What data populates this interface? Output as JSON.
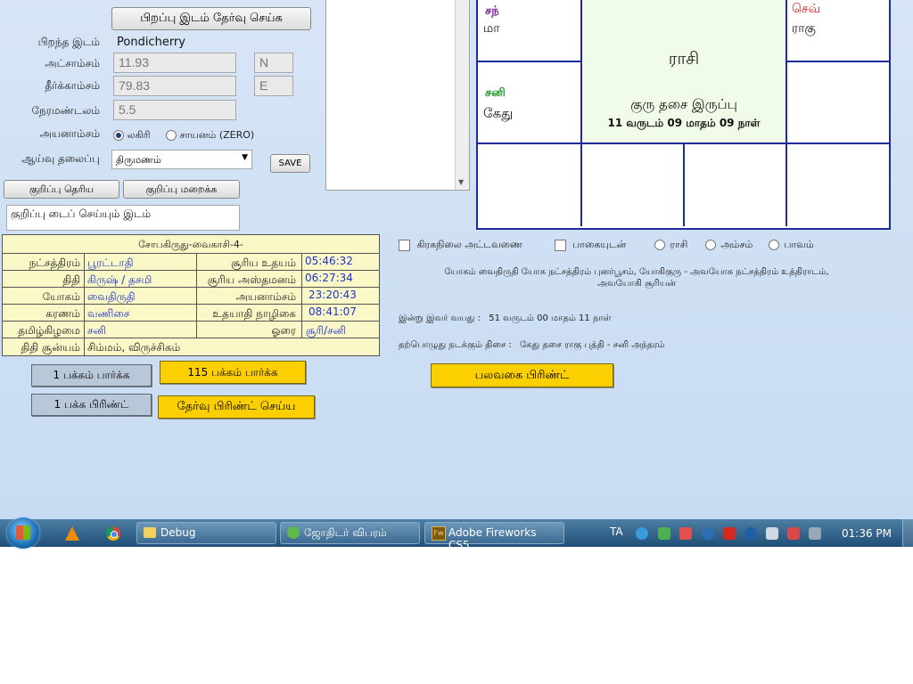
{
  "form": {
    "select_place_button": "பிறப்பு இடம் தேர்வு செய்க",
    "birth_place_label": "பிறந்த இடம்",
    "birth_place_value": "Pondicherry",
    "latitude_label": "அட்சாம்சம்",
    "latitude_value": "11.93",
    "latitude_dir": "N",
    "longitude_label": "தீர்க்காம்சம்",
    "longitude_value": "79.83",
    "longitude_dir": "E",
    "timezone_label": "நேரமண்டலம்",
    "timezone_value": "5.5",
    "ayanamsa_label": "அயனாம்சம்",
    "ayanamsa_options": [
      "லகிரி",
      "சாயனம் (ZERO)"
    ],
    "topic_label": "ஆய்வு தலைப்பு",
    "topic_value": "திருமணம்",
    "save_button": "SAVE",
    "show_notes_button": "குறிப்பு தெரிய",
    "hide_notes_button": "குறிப்பு மறைக்க",
    "notes_text": "குறிப்பு டைப் செய்யும் இடம்"
  },
  "chart": {
    "top_left_planet": "சந்",
    "top_left_planet2": "மா",
    "top_right_planet": "செவ்",
    "top_right_planet2": "ராகு",
    "mid_left_planet": "சனி",
    "mid_left_planet2": "கேது",
    "center_title": "ராசி",
    "center_line1": "குரு தசை இருப்பு",
    "center_line2": "11 வருடம் 09 மாதம் 09 நாள்"
  },
  "details": {
    "header": "சோபகிருது-வைகாசி-4-",
    "rows": [
      {
        "k1": "நட்சத்திரம்",
        "v1": "பூரட்டாதி",
        "k2": "சூரிய உதயம்",
        "v2": "05:46:32"
      },
      {
        "k1": "திதி",
        "v1": "கிருஷ் / தசமி",
        "k2": "சூரிய அஸ்தமனம்",
        "v2": "06:27:34"
      },
      {
        "k1": "யோகம்",
        "v1": "வைதிருதி",
        "k2": "அயனாம்சம்",
        "v2": "23:20:43"
      },
      {
        "k1": "கரணம்",
        "v1": "வணிசை",
        "k2": "உதயாதி நாழிகை",
        "v2": "08:41:07"
      },
      {
        "k1": "தமிழ்கிழமை",
        "v1": "சனி",
        "k2": "ஓரை",
        "v2": "சூரி/சனி"
      }
    ],
    "last_row_key": "திதி சூன்யம்",
    "last_row_value": "சிம்மம், விருச்சிகம்"
  },
  "buttons": {
    "view_1_page": "1 பக்கம் பார்க்க",
    "view_115_page": "115 பக்கம் பார்க்க",
    "print_1_page": "1 பக்க பிரிண்ட்",
    "print_selected": "தேர்வு பிரிண்ட் செய்ய",
    "print_various": "பலவகை பிரிண்ட்"
  },
  "options": {
    "planet_table": "கிரகநிலை அட்டவணை",
    "with_aspects": "பாகையுடன்",
    "radio_rasi": "ராசி",
    "radio_amsam": "அம்சம்",
    "radio_bhavam": "பாவம்"
  },
  "info": {
    "yoga_line1": "யோகம் வைதிருதி யோக நட்சத்திரம் புனர்பூசம், யோகிகுரு - அவயோக நட்சத்திரம் உத்திராடம்,",
    "yoga_line2": "அவயோகி சூரியன்",
    "age_label": "இன்று இவர் வயது  :",
    "age_value": "51 வருடம் 00 மாதம் 11 நாள்",
    "dasa_label": "தற்பொழுது நடக்கும் திசை :",
    "dasa_value": "கேது தசை ராகு புத்தி - சனி அந்தரம்"
  },
  "taskbar": {
    "items": [
      "Debug",
      "ஜோதிடர் விபரம்",
      "Adobe Fireworks CS5..."
    ],
    "language": "TA",
    "clock": "01:36 PM"
  },
  "colors": {
    "chart_border": "#1f2b9a",
    "yellow_button": "#fcd000",
    "table_bg": "#fbf8c8",
    "value_blue": "#1c34c8"
  }
}
